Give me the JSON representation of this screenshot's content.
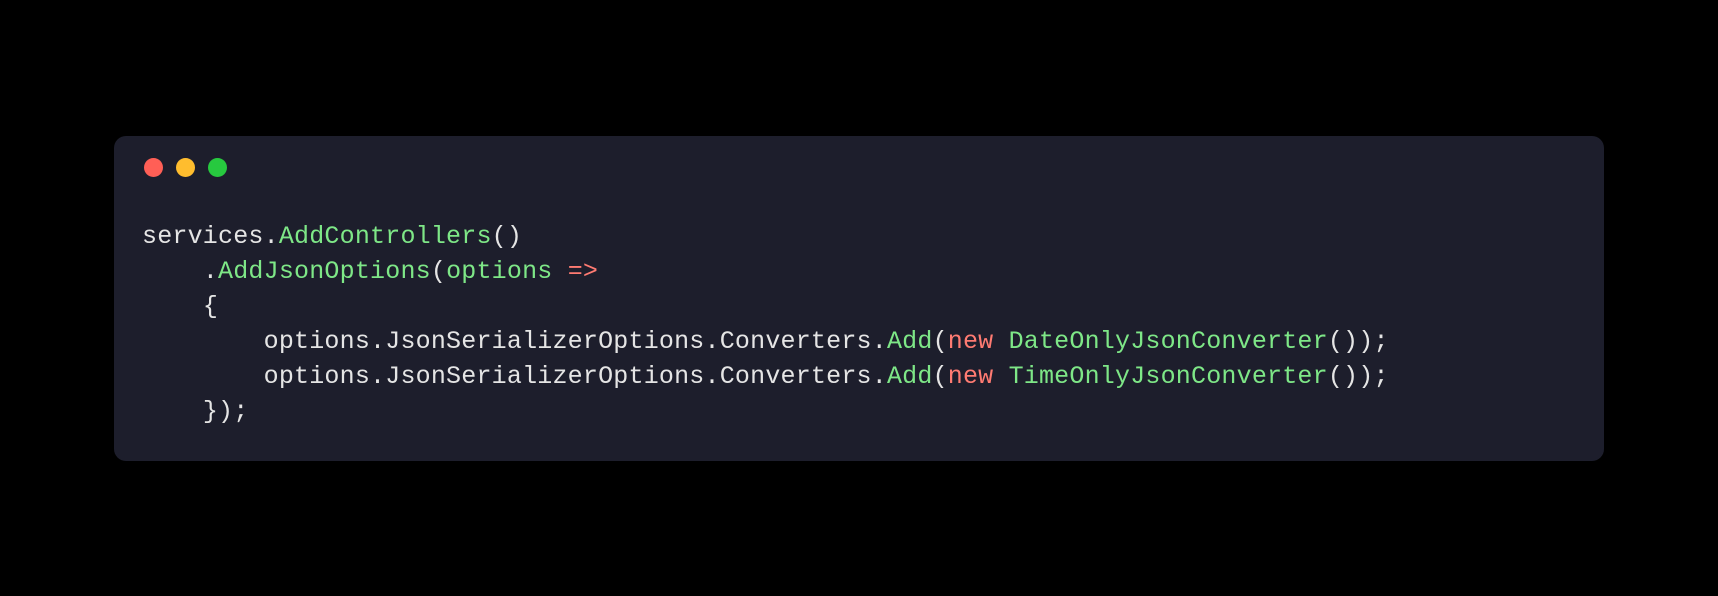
{
  "colors": {
    "bg_outer": "#000000",
    "bg_window": "#1d1e2c",
    "traffic_red": "#ff5f56",
    "traffic_yellow": "#ffbd2e",
    "traffic_green": "#27c93f",
    "tok_default": "#e5e5e5",
    "tok_method": "#7ee787",
    "tok_keyword": "#ff7b72"
  },
  "code": {
    "line1": {
      "t1": "services",
      "t2": ".",
      "t3": "AddControllers",
      "t4": "()"
    },
    "line2": {
      "indent": "    ",
      "t1": ".",
      "t2": "AddJsonOptions",
      "t3": "(",
      "t4": "options",
      "t5": " ",
      "t6": "=>"
    },
    "line3": {
      "indent": "    ",
      "t1": "{"
    },
    "line4": {
      "indent": "        ",
      "t1": "options",
      "t2": ".",
      "t3": "JsonSerializerOptions",
      "t4": ".",
      "t5": "Converters",
      "t6": ".",
      "t7": "Add",
      "t8": "(",
      "t9": "new",
      "t10": " ",
      "t11": "DateOnlyJsonConverter",
      "t12": "());"
    },
    "line5": {
      "indent": "        ",
      "t1": "options",
      "t2": ".",
      "t3": "JsonSerializerOptions",
      "t4": ".",
      "t5": "Converters",
      "t6": ".",
      "t7": "Add",
      "t8": "(",
      "t9": "new",
      "t10": " ",
      "t11": "TimeOnlyJsonConverter",
      "t12": "());"
    },
    "line6": {
      "indent": "    ",
      "t1": "});"
    }
  }
}
